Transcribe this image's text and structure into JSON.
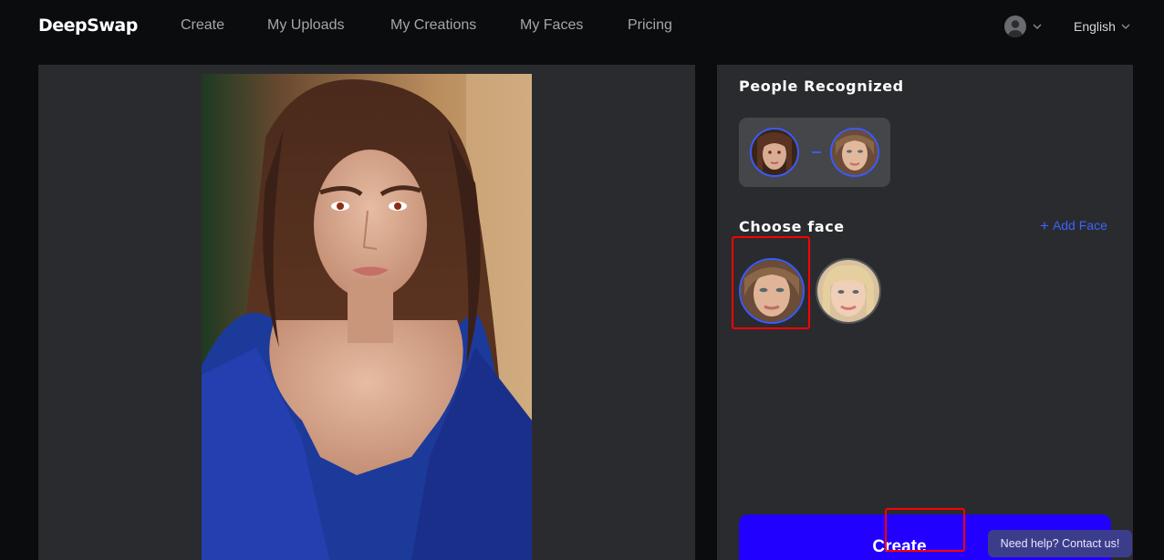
{
  "brand": {
    "name": "DeepSwap"
  },
  "nav": {
    "items": [
      {
        "label": "Create"
      },
      {
        "label": "My Uploads"
      },
      {
        "label": "My Creations"
      },
      {
        "label": "My Faces"
      },
      {
        "label": "Pricing"
      }
    ]
  },
  "header": {
    "language": "English"
  },
  "panel": {
    "people_title": "People Recognized",
    "choose_title": "Choose face",
    "add_face_label": "Add Face",
    "create_label": "Create"
  },
  "help": {
    "label": "Need help? Contact us!"
  },
  "colors": {
    "accent": "#2200ff",
    "link": "#3d63ff",
    "highlight": "#ff0000",
    "panel": "#2a2b2e"
  }
}
